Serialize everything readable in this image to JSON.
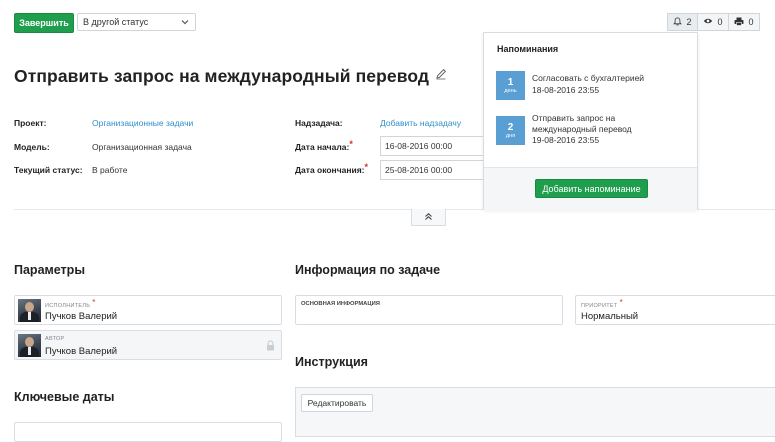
{
  "toolbar": {
    "finish_label": "Завершить",
    "status_select": "В другой статус",
    "counters": [
      {
        "icon": "bell-icon",
        "value": "2"
      },
      {
        "icon": "eye-icon",
        "value": "0"
      },
      {
        "icon": "printer-icon",
        "value": "0"
      }
    ]
  },
  "task": {
    "title": "Отправить запрос на международный перевод",
    "project_label": "Проект:",
    "project_value": "Организационные задачи",
    "model_label": "Модель:",
    "model_value": "Организационная задача",
    "status_label": "Текущий статус:",
    "status_value": "В работе",
    "parent_label": "Надзадача:",
    "parent_value": "Добавить надзадачу",
    "start_label": "Дата начала:",
    "start_value": "16-08-2016 00:00",
    "end_label": "Дата окончания:",
    "end_value": "25-08-2016 00:00",
    "required_mark": "*"
  },
  "params": {
    "heading": "Параметры",
    "assignee_label": "Исполнитель",
    "assignee_name": "Пучков Валерий",
    "author_label": "Автор",
    "author_name": "Пучков Валерий"
  },
  "key_dates": {
    "heading": "Ключевые даты"
  },
  "info": {
    "heading": "Информация по задаче",
    "main_info_label": "Основная информация",
    "priority_label": "Приоритет",
    "priority_value": "Нормальный"
  },
  "instruction": {
    "heading": "Инструкция",
    "edit_label": "Редактировать"
  },
  "reminders": {
    "title": "Напоминания",
    "items": [
      {
        "days": "1",
        "unit": "день",
        "text": "Согласовать с бухгалтерией",
        "date": "18-08-2016 23:55"
      },
      {
        "days": "2",
        "unit": "дня",
        "text_line1": "Отправить запрос на",
        "text_line2": "международный перевод",
        "date": "19-08-2016 23:55"
      }
    ],
    "add_label": "Добавить напоминание"
  },
  "colors": {
    "accent_green": "#1f9e4d",
    "link_blue": "#2f8fc9",
    "badge_blue": "#5a9fd4",
    "required_red": "#d9302c"
  }
}
